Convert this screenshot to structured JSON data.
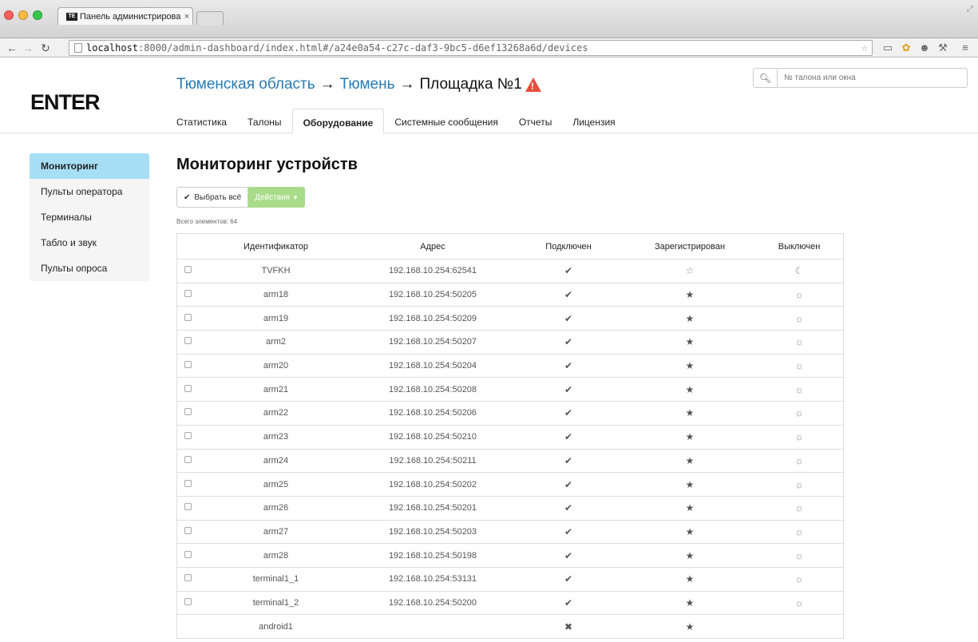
{
  "browser": {
    "tab_title": "Панель администрирован",
    "tab_close": "×",
    "favicon_text": "ТЕ",
    "url_host": "localhost",
    "url_path": ":8000/admin-dashboard/index.html#/a24e0a54-c27c-daf3-9bc5-d6ef13268a6d/devices"
  },
  "header": {
    "logo": "ENTER",
    "breadcrumb": [
      {
        "label": "Тюменская область"
      },
      {
        "label": "Тюмень"
      },
      {
        "label": "Площадка №1"
      }
    ],
    "arrow": "→",
    "search_placeholder": "№ талона или окна"
  },
  "nav_tabs": [
    {
      "label": "Статистика",
      "active": false
    },
    {
      "label": "Талоны",
      "active": false
    },
    {
      "label": "Оборудование",
      "active": true
    },
    {
      "label": "Системные сообщения",
      "active": false
    },
    {
      "label": "Отчеты",
      "active": false
    },
    {
      "label": "Лицензия",
      "active": false
    }
  ],
  "sidebar": {
    "items": [
      {
        "label": "Мониторинг",
        "active": true
      },
      {
        "label": "Пульты оператора",
        "active": false
      },
      {
        "label": "Терминалы",
        "active": false
      },
      {
        "label": "Табло и звук",
        "active": false
      },
      {
        "label": "Пульты опроса",
        "active": false
      }
    ]
  },
  "main": {
    "title": "Мониторинг устройств",
    "select_all": "Выбрать всё",
    "actions": "Действия",
    "total": "Всего элементов: 64"
  },
  "table": {
    "columns": [
      "Идентификатор",
      "Адрес",
      "Подключен",
      "Зарегистрирован",
      "Выключен"
    ],
    "rows": [
      {
        "id": "TVFKH",
        "addr": "192.168.10.254:62541",
        "conn": "check",
        "reg": "star-empty",
        "off": "moon",
        "checkbox": true
      },
      {
        "id": "arm18",
        "addr": "192.168.10.254:50205",
        "conn": "check",
        "reg": "star",
        "off": "sun",
        "checkbox": true
      },
      {
        "id": "arm19",
        "addr": "192.168.10.254:50209",
        "conn": "check",
        "reg": "star",
        "off": "sun",
        "checkbox": true
      },
      {
        "id": "arm2",
        "addr": "192.168.10.254:50207",
        "conn": "check",
        "reg": "star",
        "off": "sun",
        "checkbox": true
      },
      {
        "id": "arm20",
        "addr": "192.168.10.254:50204",
        "conn": "check",
        "reg": "star",
        "off": "sun",
        "checkbox": true
      },
      {
        "id": "arm21",
        "addr": "192.168.10.254:50208",
        "conn": "check",
        "reg": "star",
        "off": "sun",
        "checkbox": true
      },
      {
        "id": "arm22",
        "addr": "192.168.10.254:50206",
        "conn": "check",
        "reg": "star",
        "off": "sun",
        "checkbox": true
      },
      {
        "id": "arm23",
        "addr": "192.168.10.254:50210",
        "conn": "check",
        "reg": "star",
        "off": "sun",
        "checkbox": true
      },
      {
        "id": "arm24",
        "addr": "192.168.10.254:50211",
        "conn": "check",
        "reg": "star",
        "off": "sun",
        "checkbox": true
      },
      {
        "id": "arm25",
        "addr": "192.168.10.254:50202",
        "conn": "check",
        "reg": "star",
        "off": "sun",
        "checkbox": true
      },
      {
        "id": "arm26",
        "addr": "192.168.10.254:50201",
        "conn": "check",
        "reg": "star",
        "off": "sun",
        "checkbox": true
      },
      {
        "id": "arm27",
        "addr": "192.168.10.254:50203",
        "conn": "check",
        "reg": "star",
        "off": "sun",
        "checkbox": true
      },
      {
        "id": "arm28",
        "addr": "192.168.10.254:50198",
        "conn": "check",
        "reg": "star",
        "off": "sun",
        "checkbox": true
      },
      {
        "id": "terminal1_1",
        "addr": "192.168.10.254:53131",
        "conn": "check",
        "reg": "star",
        "off": "sun",
        "checkbox": true
      },
      {
        "id": "terminal1_2",
        "addr": "192.168.10.254:50200",
        "conn": "check",
        "reg": "star",
        "off": "sun",
        "checkbox": true
      },
      {
        "id": "android1",
        "addr": "",
        "conn": "x",
        "reg": "star",
        "off": "",
        "checkbox": false
      }
    ]
  },
  "icons": {
    "check": "✔",
    "x": "✖",
    "star": "★",
    "star-empty": "☆",
    "moon": "☾",
    "sun": "☼"
  },
  "colors": {
    "link": "#2a7ab0",
    "warning": "#e74c3c",
    "sidebar_active": "#a6dff5",
    "actions_button": "#a9dc8a"
  }
}
